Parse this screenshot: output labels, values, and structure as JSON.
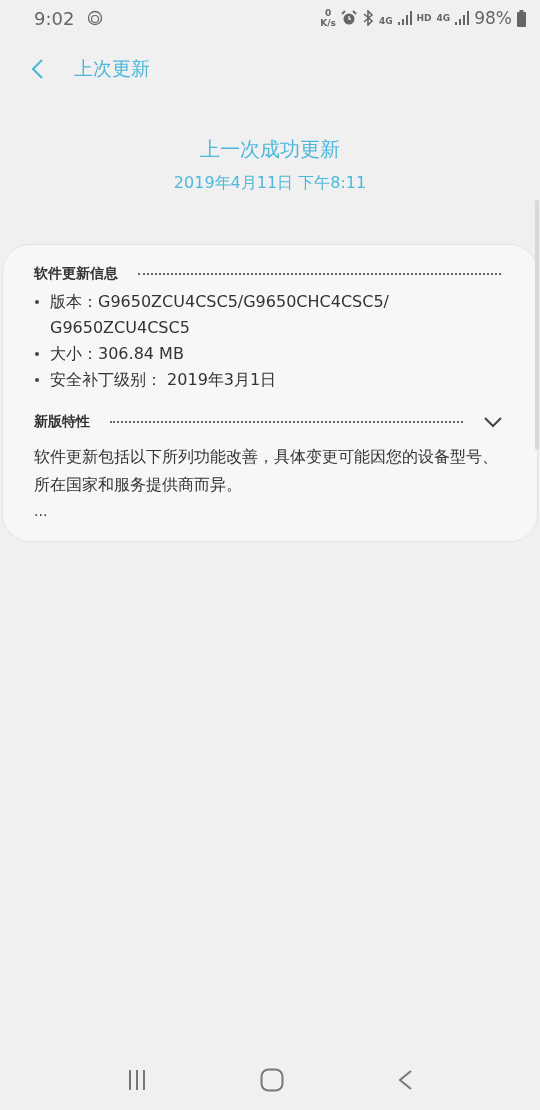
{
  "status_bar": {
    "time": "9:02",
    "speed_value": "0",
    "speed_unit": "K/s",
    "network_1": "4G",
    "hd": "HD",
    "network_2": "4G",
    "battery": "98%"
  },
  "header": {
    "title": "上次更新"
  },
  "summary": {
    "title": "上一次成功更新",
    "date": "2019年4月11日 下午8:11"
  },
  "card": {
    "sections": [
      {
        "kind": "list",
        "title": "软件更新信息",
        "items": [
          "版本：G9650ZCU4CSC5/G9650CHC4CSC5/ G9650ZCU4CSC5",
          "大小：306.84 MB",
          "安全补丁级别： 2019年3月1日"
        ]
      },
      {
        "kind": "text",
        "title": "新版特性",
        "expanded": false,
        "text": "软件更新包括以下所列功能改善，具体变更可能因您的设备型号、所在国家和服务提供商而异。",
        "more": "..."
      }
    ]
  }
}
